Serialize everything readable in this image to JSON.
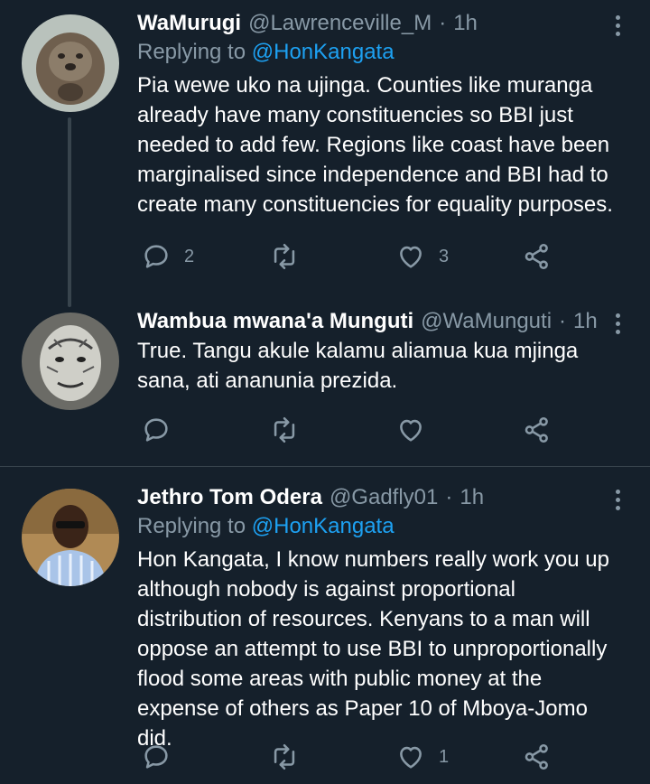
{
  "tweets": [
    {
      "name": "WaMurugi",
      "handle": "@Lawrenceville_M",
      "separator": "·",
      "time": "1h",
      "replying_prefix": "Replying to",
      "replying_to": "@HonKangata",
      "text": "Pia wewe uko na ujinga. Counties like muranga already have many constituencies so BBI just needed to add few. Regions like coast have been marginalised since independence and BBI had to create  many constituencies for equality purposes.",
      "replies": "2",
      "retweets": "",
      "likes": "3"
    },
    {
      "name": "Wambua mwana'a Munguti",
      "handle": "@WaMunguti",
      "separator": "·",
      "time": "1h",
      "text": "True. Tangu akule kalamu aliamua kua mjinga sana, ati ananunia prezida.",
      "replies": "",
      "retweets": "",
      "likes": ""
    },
    {
      "name": "Jethro Tom Odera",
      "handle": "@Gadfly01",
      "separator": "·",
      "time": "1h",
      "replying_prefix": "Replying to",
      "replying_to": "@HonKangata",
      "text": "Hon Kangata, I know numbers really work you up although nobody is against proportional distribution of resources. Kenyans to a man will oppose an attempt to use BBI to unproportionally flood some areas with public money at the expense of others as Paper 10 of Mboya-Jomo did.",
      "replies": "",
      "retweets": "",
      "likes": "1"
    }
  ],
  "colors": {
    "background": "#15202b",
    "secondary_text": "#8899a6",
    "link": "#1da1f2",
    "divider": "#38444d"
  },
  "icons": {
    "reply": "reply-icon",
    "retweet": "retweet-icon",
    "like": "heart-icon",
    "share": "share-icon",
    "more": "more-vertical-icon"
  }
}
